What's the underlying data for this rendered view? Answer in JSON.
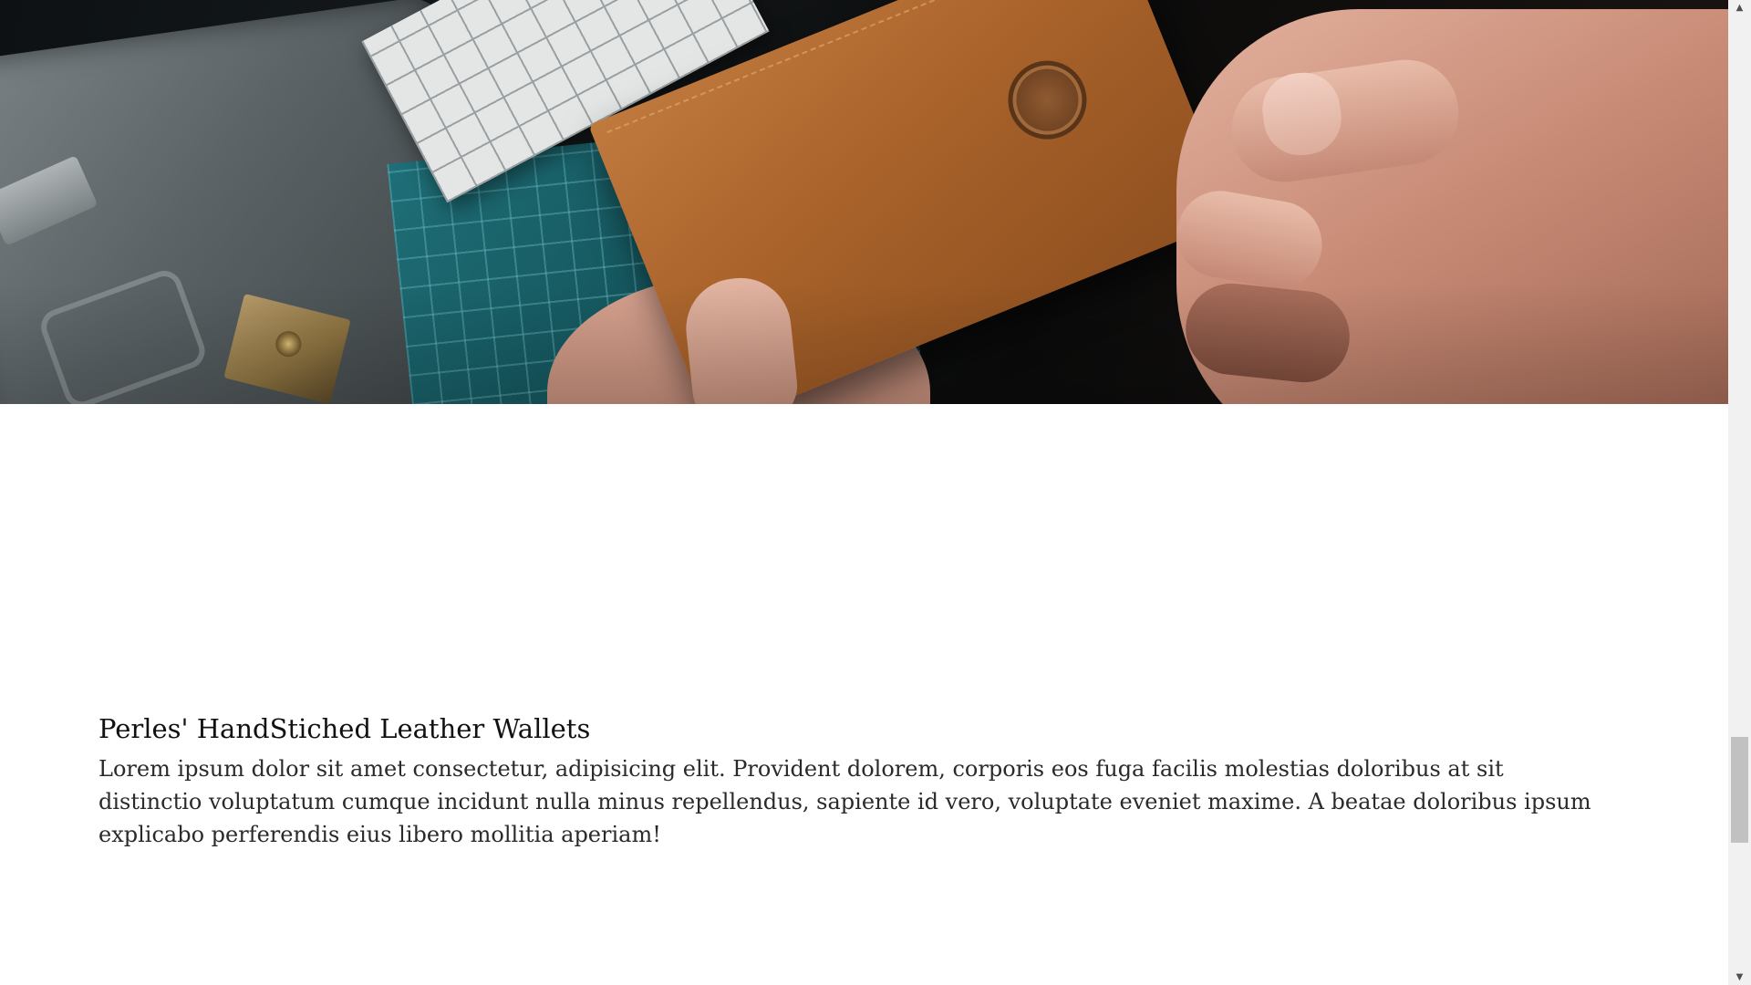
{
  "article": {
    "title": "Perles' HandStiched Leather Wallets",
    "body": "Lorem ipsum dolor sit amet consectetur, adipisicing elit. Provident dolorem, corporis eos fuga facilis molestias doloribus at sit distinctio voluptatum cumque incidunt nulla minus repellendus, sapiente id vero, voluptate eveniet maxime. A beatae doloribus ipsum explicabo perferendis eius libero mollitia aperiam!"
  },
  "scrollbar": {
    "up_icon": "▲",
    "down_icon": "▼",
    "scroll_position": 0.75
  },
  "colors": {
    "page_background": "#ffffff",
    "text": "#2a2a2a",
    "heading": "#111111",
    "leather": "#a8622a"
  }
}
